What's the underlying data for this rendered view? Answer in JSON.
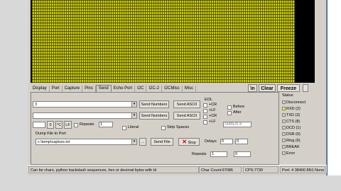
{
  "tabs": [
    "Display",
    "Port",
    "Capture",
    "Pins",
    "Send",
    "Echo Port",
    "I2C",
    "I2C-2",
    "I2CMisc",
    "Misc"
  ],
  "top_buttons": {
    "newline": "\\n",
    "clear": "Clear",
    "freeze": "Freeze"
  },
  "send": {
    "input1_value": "3",
    "send_numbers_label": "Send Numbers",
    "send_ascii_label": "Send ASCII",
    "zero_label": "0",
    "c_label": "^C",
    "lf_label": "LF",
    "repeats_label": "Repeats",
    "repeats_value": "1",
    "literal_label": "Literal",
    "strip_spaces_label": "Strip Spaces"
  },
  "eol": {
    "title": "EOL",
    "options": [
      "+CR",
      "+LF",
      "+CR",
      "+LF"
    ],
    "before_label": "Before",
    "after_label": "After",
    "smbus_label": "SMBUS 8"
  },
  "dump": {
    "title": "Dump File to Port",
    "path": "c:\\temp\\capture.txt",
    "send_file_label": "Send File",
    "stop_label": "Stop",
    "delays_label": "Delays",
    "delay1": "0",
    "delay2": "0",
    "repeats_label": "Repeats",
    "repeats1": "1",
    "repeats2": "0"
  },
  "status": {
    "title": "Status",
    "items": [
      {
        "label": "Disconnect",
        "on": false
      },
      {
        "label": "RXD (2)",
        "on": true
      },
      {
        "label": "TXD (3)",
        "on": false
      },
      {
        "label": "CTS (8)",
        "on": false
      },
      {
        "label": "DCD (1)",
        "on": false
      },
      {
        "label": "DSR (6)",
        "on": false
      },
      {
        "label": "Ring (9)",
        "on": false
      },
      {
        "label": "BREAK",
        "on": false
      },
      {
        "label": "Error",
        "on": false
      }
    ]
  },
  "statusbar": {
    "hint": "Can be chars, python backslash sequences, hex or decimal bytes with bl",
    "char_count": "Char Count:97086",
    "cps": "CPS:7730",
    "port": "Port: 4  38400 8N1 None"
  },
  "colors": {
    "terminal_bg": "#000000",
    "terminal_text": "#c8c800",
    "led_on": "#ffff00"
  }
}
